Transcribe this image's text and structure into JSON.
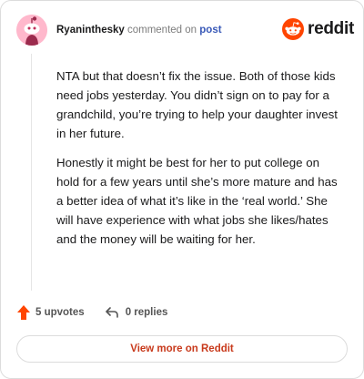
{
  "comment": {
    "username": "Ryaninthesky",
    "verb": "commented on",
    "post_link": "post",
    "paragraphs": [
      "NTA but that doesn’t fix the issue. Both of those kids need jobs yesterday. You didn’t sign on to pay for a grandchild, you’re trying to help your daughter invest in her future.",
      "Honestly it might be best for her to put college on hold for a few years until she’s more mature and has a better idea of what it’s like in the ‘real world.’ She will have experience with what jobs she likes/hates and the money will be waiting for her."
    ]
  },
  "brand": {
    "wordmark": "reddit",
    "icon": "reddit-snoo-icon",
    "color": "#ff4500"
  },
  "actions": {
    "upvotes_label": "5 upvotes",
    "upvote_icon": "upvote-arrow-icon",
    "replies_label": "0 replies",
    "reply_icon": "reply-arrow-icon"
  },
  "cta": {
    "label": "View more on Reddit",
    "color": "#c83a1c"
  },
  "colors": {
    "upvote": "#ff4500",
    "avatar_bg": "#ffb8cc",
    "link": "#3a5ab8"
  }
}
